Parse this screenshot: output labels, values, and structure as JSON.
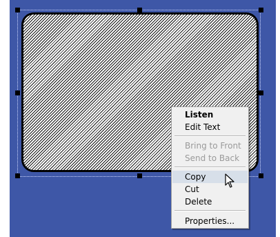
{
  "colors": {
    "workspace_bg": "#3e57a7",
    "menu_bg": "#f0f0f0",
    "menu_highlight": "#d7dfe9",
    "text": "#000000",
    "disabled_text": "#9a9a9a"
  },
  "context_menu": {
    "items": [
      {
        "label": "Listen"
      },
      {
        "label": "Edit Text"
      },
      {
        "label": "Bring to Front"
      },
      {
        "label": "Send to Back"
      },
      {
        "label": "Copy"
      },
      {
        "label": "Cut"
      },
      {
        "label": "Delete"
      },
      {
        "label": "Properties..."
      }
    ]
  },
  "icons": {
    "cursor": "arrow-cursor-icon"
  }
}
